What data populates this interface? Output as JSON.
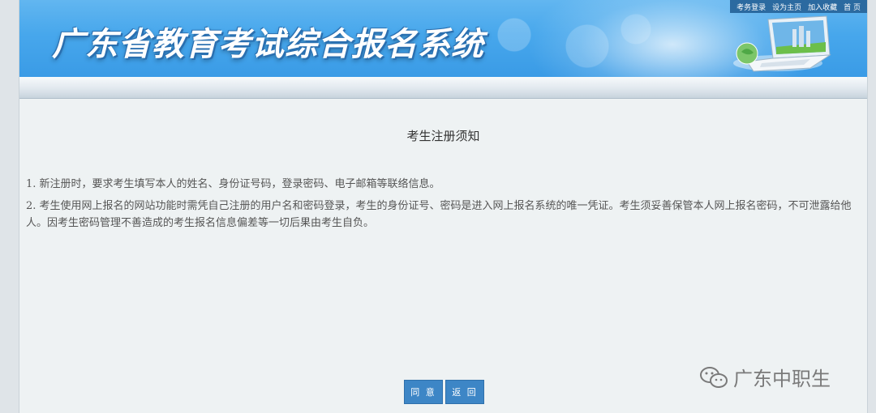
{
  "header": {
    "title": "广东省教育考试综合报名系统",
    "links": [
      "考务登录",
      "设为主页",
      "加入收藏",
      "首 页"
    ]
  },
  "notice": {
    "title": "考生注册须知",
    "items": [
      "1. 新注册时，要求考生填写本人的姓名、身份证号码，登录密码、电子邮箱等联络信息。",
      "2.  考生使用网上报名的网站功能时需凭自己注册的用户名和密码登录，考生的身份证号、密码是进入网上报名系统的唯一凭证。考生须妥善保管本人网上报名密码，不可泄露给他人。因考生密码管理不善造成的考生报名信息偏差等一切后果由考生自负。"
    ]
  },
  "buttons": {
    "agree": "同 意",
    "back": "返 回"
  },
  "watermark": {
    "text": "广东中职生",
    "icon": "wechat-icon"
  },
  "colors": {
    "banner": "#47a7ec",
    "button": "#3d86c6",
    "background": "#eef2f3"
  }
}
